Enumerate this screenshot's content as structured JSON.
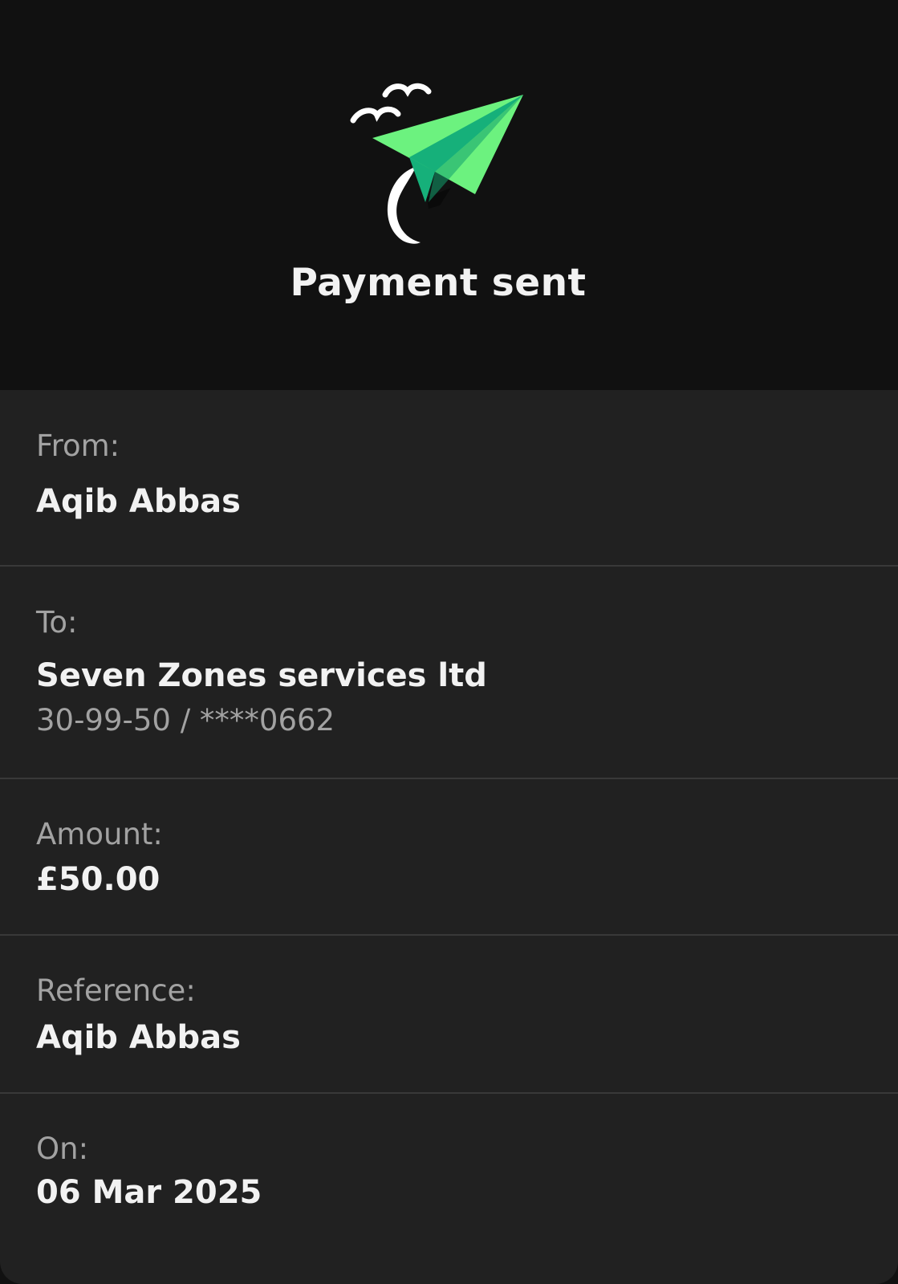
{
  "header": {
    "icon": "paper-plane-icon",
    "title": "Payment sent"
  },
  "details": {
    "from_label": "From:",
    "from_value": "Aqib Abbas",
    "to_label": "To:",
    "to_value": "Seven Zones services ltd",
    "to_account": "30-99-50 / ****0662",
    "amount_label": "Amount:",
    "amount_value": "£50.00",
    "reference_label": "Reference:",
    "reference_value": "Aqib Abbas",
    "date_label": "On:",
    "date_value": "06 Mar 2025"
  },
  "colors": {
    "background": "#111111",
    "card": "#212121",
    "divider": "#393939",
    "plane_light_green": "#6CF27F",
    "plane_dark_green": "#16B07A",
    "text_primary": "#f2f2f2",
    "text_secondary": "#a2a2a2"
  }
}
